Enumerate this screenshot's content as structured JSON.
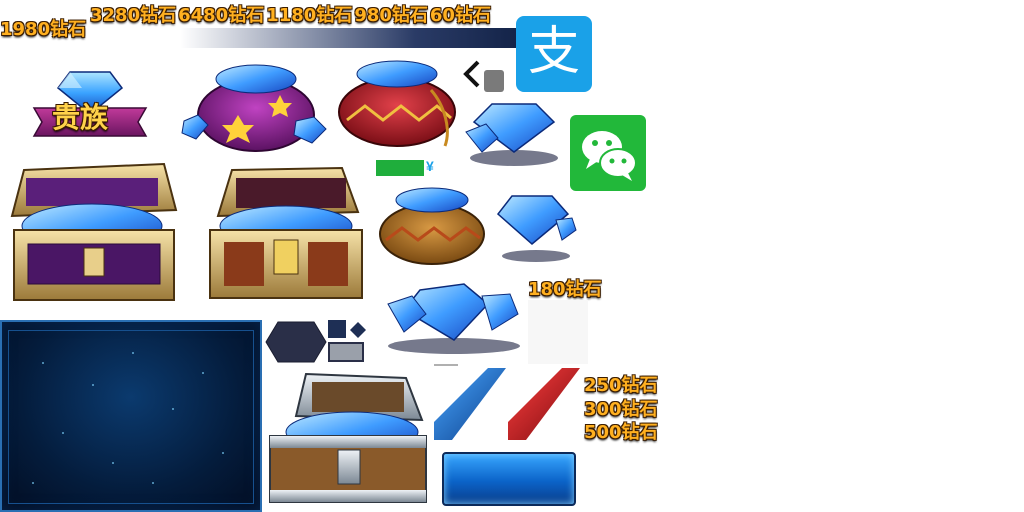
{
  "labels": {
    "price_1980": "1980钻石",
    "price_3280": "3280钻石",
    "price_6480": "6480钻石",
    "price_1180": "1180钻石",
    "price_980": "980钻石",
    "price_60": "60钻石",
    "price_180": "180钻石",
    "price_250": "250钻石",
    "price_300": "300钻石",
    "price_500": "500钻石",
    "noble": "贵族",
    "yuan_symbol": "¥"
  },
  "payments": {
    "alipay_glyph": "支",
    "alipay_color": "#1aa1e8",
    "wechat_color": "#22b83a"
  },
  "icons": {
    "back": "chevron-left-icon",
    "alipay": "alipay-icon",
    "wechat": "wechat-icon"
  },
  "colors": {
    "gold_text": "#ffb020",
    "diamond_blue": "#3aa2ff",
    "purple_bag": "#8a2a8f",
    "red_bag": "#b8242c",
    "tab_blue": "#1f6fd0",
    "tab_red": "#c0161e"
  }
}
